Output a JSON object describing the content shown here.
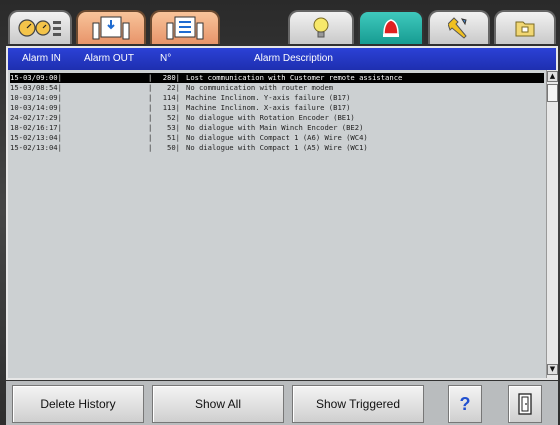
{
  "tabs": [
    {
      "icon": "gauges-icon"
    },
    {
      "icon": "winch-icon"
    },
    {
      "icon": "winch-list-icon"
    },
    {
      "icon": "lightbulb-icon"
    },
    {
      "icon": "alarm-bell-icon"
    },
    {
      "icon": "tools-icon"
    },
    {
      "icon": "folder-icon"
    }
  ],
  "columns": {
    "alarm_in": "Alarm IN",
    "alarm_out": "Alarm OUT",
    "number": "N°",
    "description": "Alarm Description"
  },
  "alarms": [
    {
      "in": "15-03/09:00|",
      "out": "|",
      "n": "280|",
      "desc": "Lost communication with Customer remote assistance"
    },
    {
      "in": "15-03/08:54|",
      "out": "|",
      "n": "22|",
      "desc": "No communication with router modem"
    },
    {
      "in": "10-03/14:09|",
      "out": "|",
      "n": "114|",
      "desc": "Machine Inclinom. Y-axis failure (B17)"
    },
    {
      "in": "10-03/14:09|",
      "out": "|",
      "n": "113|",
      "desc": "Machine Inclinom. X-axis failure (B17)"
    },
    {
      "in": "24-02/17:29|",
      "out": "|",
      "n": "52|",
      "desc": "No dialogue with Rotation Encoder (BE1)"
    },
    {
      "in": "18-02/16:17|",
      "out": "|",
      "n": "53|",
      "desc": "No dialogue with Main Winch Encoder (BE2)"
    },
    {
      "in": "15-02/13:04|",
      "out": "|",
      "n": "51|",
      "desc": "No dialogue with Compact 1 (A6) Wire (WC4)"
    },
    {
      "in": "15-02/13:04|",
      "out": "|",
      "n": "50|",
      "desc": "No dialogue with Compact 1 (A5) Wire (WC1)"
    }
  ],
  "scroll": {
    "up": "▲",
    "down": "▼"
  },
  "buttons": {
    "delete_history": "Delete History",
    "show_all": "Show All",
    "show_triggered": "Show Triggered",
    "help": "?"
  },
  "colors": {
    "header_blue": "#1e2fb0",
    "active_tab": "#179c92",
    "orange_tab": "#e8946a"
  }
}
